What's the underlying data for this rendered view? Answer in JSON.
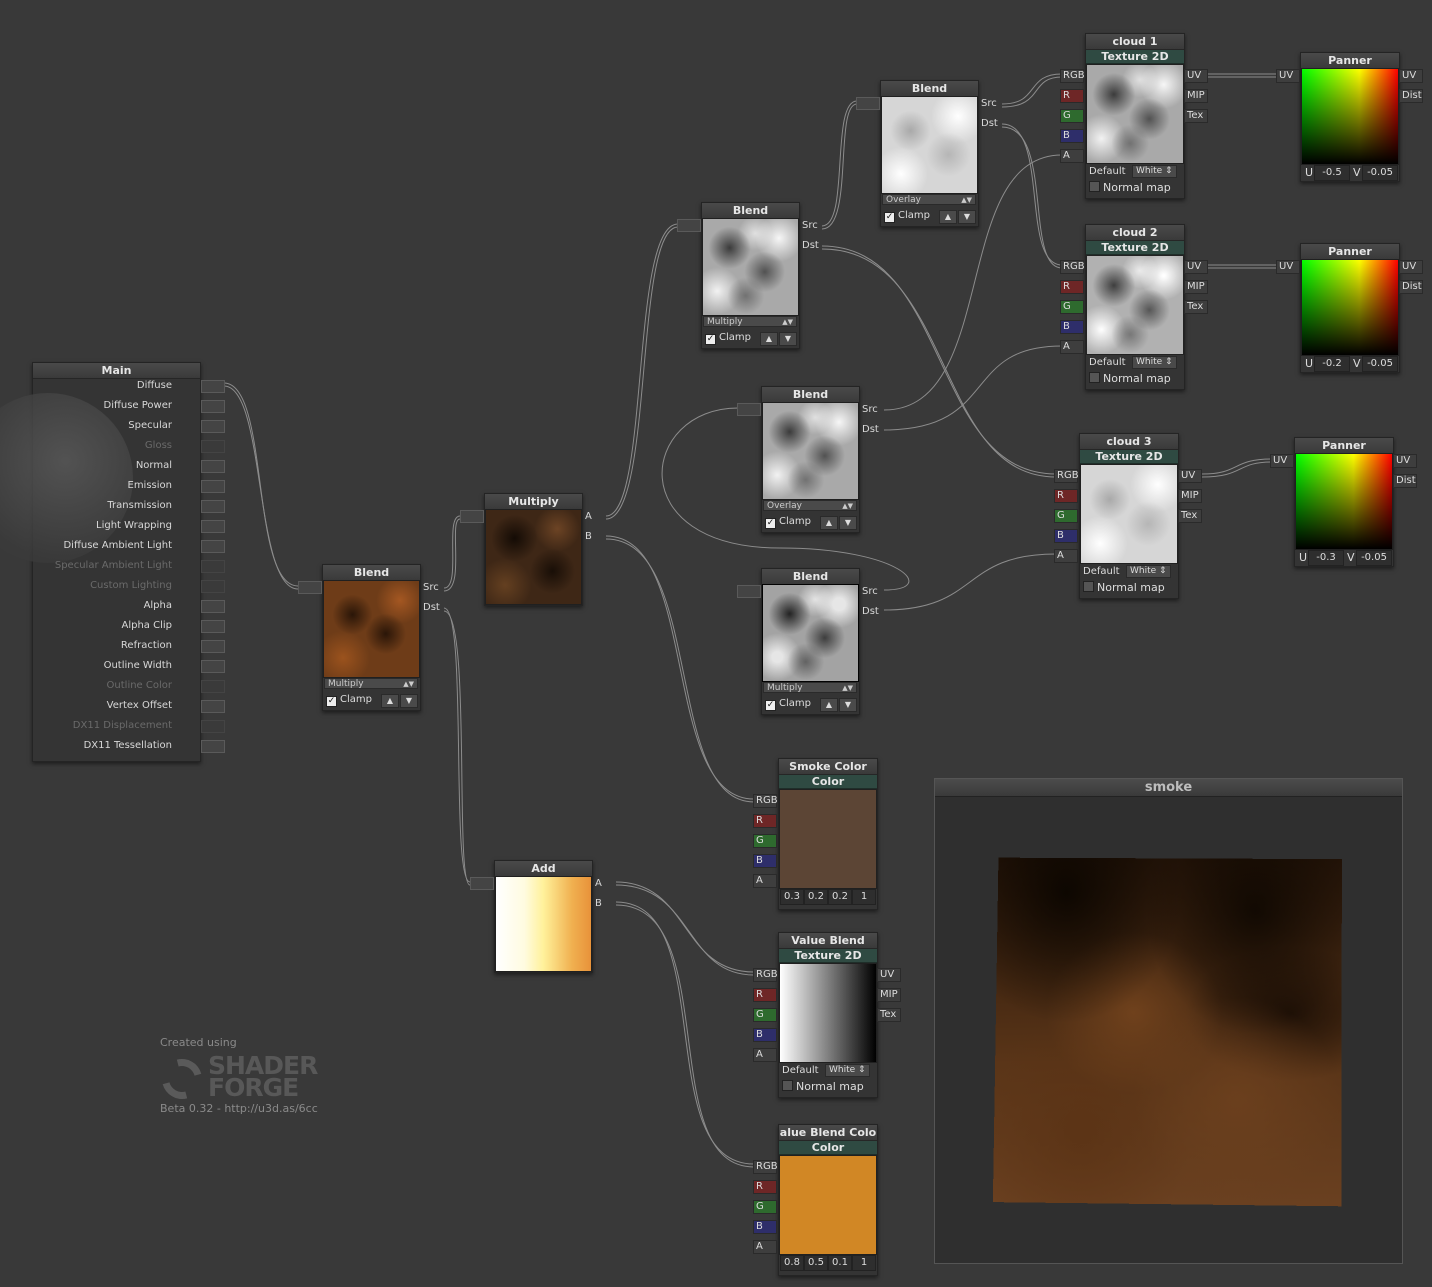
{
  "main": {
    "title": "Main",
    "inputs": [
      {
        "label": "Diffuse",
        "active": true
      },
      {
        "label": "Diffuse Power",
        "active": true
      },
      {
        "label": "Specular",
        "active": true
      },
      {
        "label": "Gloss",
        "active": false
      },
      {
        "label": "Normal",
        "active": true
      },
      {
        "label": "Emission",
        "active": true
      },
      {
        "label": "Transmission",
        "active": true
      },
      {
        "label": "Light Wrapping",
        "active": true
      },
      {
        "label": "Diffuse Ambient Light",
        "active": true
      },
      {
        "label": "Specular Ambient Light",
        "active": false
      },
      {
        "label": "Custom Lighting",
        "active": false
      },
      {
        "label": "Alpha",
        "active": true
      },
      {
        "label": "Alpha Clip",
        "active": true
      },
      {
        "label": "Refraction",
        "active": true
      },
      {
        "label": "Outline Width",
        "active": true
      },
      {
        "label": "Outline Color",
        "active": false
      },
      {
        "label": "Vertex Offset",
        "active": true
      },
      {
        "label": "DX11 Displacement",
        "active": false
      },
      {
        "label": "DX11 Tessellation",
        "active": true
      }
    ]
  },
  "blend_main": {
    "title": "Blend",
    "mode": "Multiply",
    "clamp": "Clamp",
    "ports": [
      "Src",
      "Dst"
    ]
  },
  "multiply": {
    "title": "Multiply",
    "ports": [
      "A",
      "B"
    ]
  },
  "blend_top": {
    "title": "Blend",
    "mode": "Multiply",
    "clamp": "Clamp",
    "ports": [
      "Src",
      "Dst"
    ]
  },
  "blend_topmost": {
    "title": "Blend",
    "mode": "Overlay",
    "clamp": "Clamp",
    "ports": [
      "Src",
      "Dst"
    ]
  },
  "blend_mid": {
    "title": "Blend",
    "mode": "Overlay",
    "clamp": "Clamp",
    "ports": [
      "Src",
      "Dst"
    ]
  },
  "blend_low": {
    "title": "Blend",
    "mode": "Multiply",
    "clamp": "Clamp",
    "ports": [
      "Src",
      "Dst"
    ]
  },
  "add": {
    "title": "Add",
    "ports": [
      "A",
      "B"
    ]
  },
  "cloud1": {
    "title": "cloud 1",
    "subtitle": "Texture 2D",
    "in": [
      "RGB",
      "R",
      "G",
      "B",
      "A"
    ],
    "out": [
      "UV",
      "MIP",
      "Tex"
    ],
    "default": "Default",
    "white": "White",
    "normal": "Normal map"
  },
  "cloud2": {
    "title": "cloud 2",
    "subtitle": "Texture 2D",
    "in": [
      "RGB",
      "R",
      "G",
      "B",
      "A"
    ],
    "out": [
      "UV",
      "MIP",
      "Tex"
    ],
    "default": "Default",
    "white": "White",
    "normal": "Normal map"
  },
  "cloud3": {
    "title": "cloud 3",
    "subtitle": "Texture 2D",
    "in": [
      "RGB",
      "R",
      "G",
      "B",
      "A"
    ],
    "out": [
      "UV",
      "MIP",
      "Tex"
    ],
    "default": "Default",
    "white": "White",
    "normal": "Normal map"
  },
  "panner1": {
    "title": "Panner",
    "in": "UV",
    "out": [
      "UV",
      "Dist"
    ],
    "u_label": "U",
    "u": "-0.5",
    "v_label": "V",
    "v": "-0.05"
  },
  "panner2": {
    "title": "Panner",
    "in": "UV",
    "out": [
      "UV",
      "Dist"
    ],
    "u_label": "U",
    "u": "-0.2",
    "v_label": "V",
    "v": "-0.05"
  },
  "panner3": {
    "title": "Panner",
    "in": "UV",
    "out": [
      "UV",
      "Dist"
    ],
    "u_label": "U",
    "u": "-0.3",
    "v_label": "V",
    "v": "-0.05"
  },
  "smoke_color": {
    "title": "Smoke Color",
    "subtitle": "Color",
    "in": [
      "RGB",
      "R",
      "G",
      "B",
      "A"
    ],
    "values": [
      "0.3",
      "0.2",
      "0.2",
      "1"
    ],
    "swatch": "#5c4535"
  },
  "value_blend": {
    "title": "Value Blend",
    "subtitle": "Texture 2D",
    "in": [
      "RGB",
      "R",
      "G",
      "B",
      "A"
    ],
    "out": [
      "UV",
      "MIP",
      "Tex"
    ],
    "default": "Default",
    "white": "White",
    "normal": "Normal map"
  },
  "value_blend_color": {
    "title": "alue Blend Colo",
    "subtitle": "Color",
    "in": [
      "RGB",
      "R",
      "G",
      "B",
      "A"
    ],
    "values": [
      "0.8",
      "0.5",
      "0.1",
      "1"
    ],
    "swatch": "#d18725"
  },
  "preview": {
    "title": "smoke"
  },
  "branding": {
    "created": "Created using",
    "logo_top": "SHADER",
    "logo_bottom": "FORGE",
    "version": "Beta 0.32 - http://u3d.as/6cc"
  },
  "colors": {
    "background": "#393939",
    "node": "#343434",
    "texture_header": "#2f4a42",
    "wire": "#8a8a8a"
  }
}
